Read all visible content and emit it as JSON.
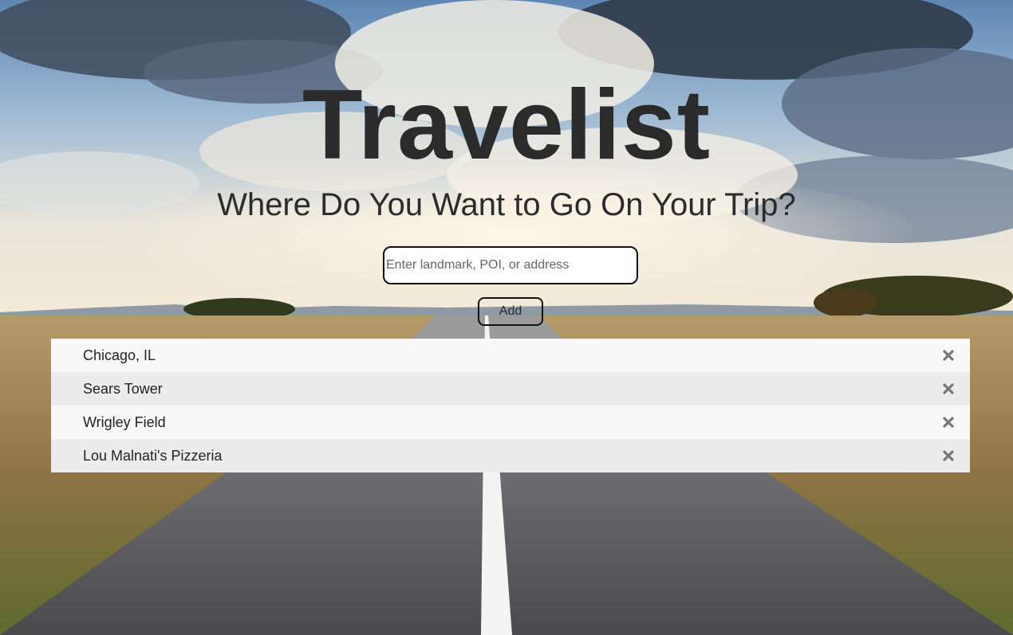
{
  "header": {
    "title": "Travelist",
    "subtitle": "Where Do You Want to Go On Your Trip?"
  },
  "search": {
    "value": "",
    "placeholder": "Enter landmark, POI, or address"
  },
  "add_button": {
    "label": "Add"
  },
  "trip_list": {
    "items": [
      {
        "label": "Chicago, IL",
        "remove_icon": "close-icon"
      },
      {
        "label": "Sears Tower",
        "remove_icon": "close-icon"
      },
      {
        "label": "Wrigley Field",
        "remove_icon": "close-icon"
      },
      {
        "label": "Lou Malnati's Pizzeria",
        "remove_icon": "close-icon"
      }
    ]
  },
  "colors": {
    "text": "#2b2b2b",
    "row_odd": "#f8f8f8",
    "row_even": "#ececec",
    "remove_icon": "#777777"
  }
}
